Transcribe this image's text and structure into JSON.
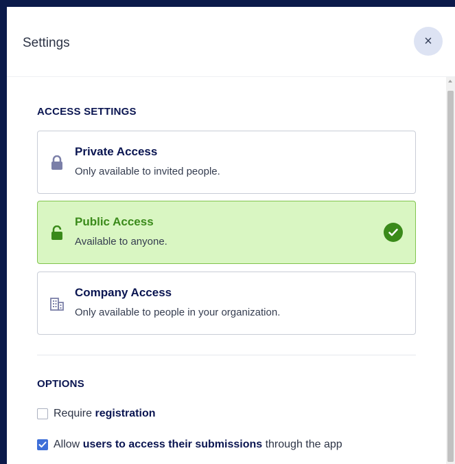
{
  "header": {
    "title": "Settings",
    "close_label": "×"
  },
  "access": {
    "section_title": "ACCESS SETTINGS",
    "options": [
      {
        "title": "Private Access",
        "description": "Only available to invited people.",
        "icon": "lock-icon",
        "selected": false
      },
      {
        "title": "Public Access",
        "description": "Available to anyone.",
        "icon": "unlock-icon",
        "selected": true
      },
      {
        "title": "Company Access",
        "description": "Only available to people in your organization.",
        "icon": "building-icon",
        "selected": false
      }
    ]
  },
  "options": {
    "section_title": "OPTIONS",
    "require_registration": {
      "text_a": "Require ",
      "text_b": "registration",
      "checked": false
    },
    "allow_submissions": {
      "text_a": "Allow ",
      "text_b": "users to access their submissions",
      "text_c": " through the app",
      "checked": true
    }
  },
  "colors": {
    "accent_green": "#3a8a1a",
    "selected_bg": "#d9f6c2",
    "checkbox_blue": "#3e6fd8",
    "frame": "#0b1a4a"
  }
}
